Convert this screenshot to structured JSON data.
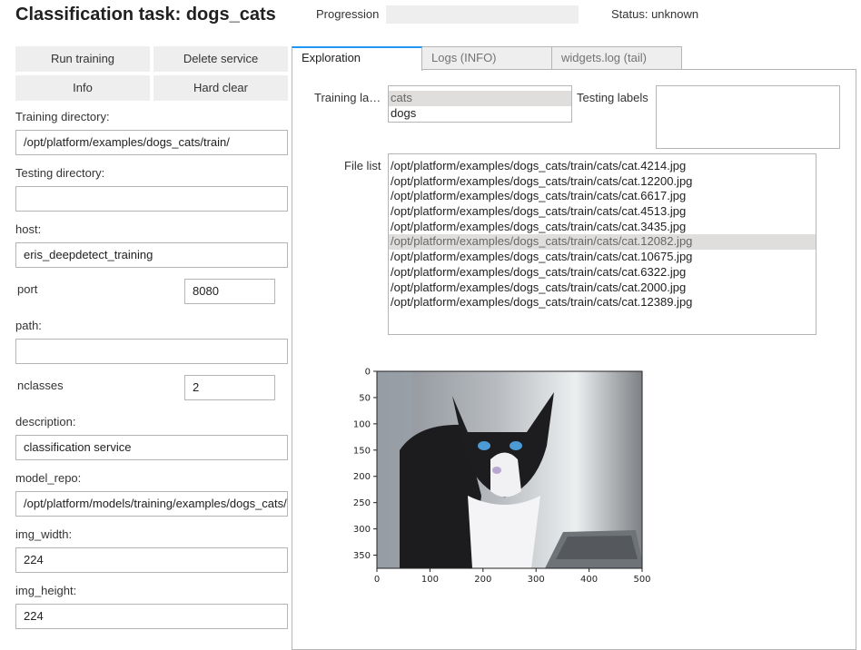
{
  "header": {
    "title": "Classification task: dogs_cats",
    "progress_label": "Progression",
    "progress_value": 0,
    "status": "Status: unknown"
  },
  "actions": {
    "run_training": "Run training",
    "delete_service": "Delete service",
    "info": "Info",
    "hard_clear": "Hard clear"
  },
  "form": {
    "training_directory": {
      "label": "Training directory:",
      "value": "/opt/platform/examples/dogs_cats/train/"
    },
    "testing_directory": {
      "label": "Testing directory:",
      "value": ""
    },
    "host": {
      "label": "host:",
      "value": "eris_deepdetect_training"
    },
    "port": {
      "label": "port",
      "value": "8080"
    },
    "path": {
      "label": "path:",
      "value": ""
    },
    "nclasses": {
      "label": "nclasses",
      "value": "2"
    },
    "description": {
      "label": "description:",
      "value": "classification service"
    },
    "model_repo": {
      "label": "model_repo:",
      "value": "/opt/platform/models/training/examples/dogs_cats/"
    },
    "img_width": {
      "label": "img_width:",
      "value": "224"
    },
    "img_height": {
      "label": "img_height:",
      "value": "224"
    }
  },
  "tabs": [
    {
      "label": "Exploration",
      "active": true
    },
    {
      "label": "Logs (INFO)",
      "active": false
    },
    {
      "label": "widgets.log (tail)",
      "active": false
    }
  ],
  "exploration": {
    "training_labels_label": "Training la…",
    "training_labels": [
      {
        "text": "cats",
        "selected": true
      },
      {
        "text": "dogs",
        "selected": false
      }
    ],
    "testing_labels_label": "Testing labels",
    "testing_labels": [],
    "file_list_label": "File list",
    "files": [
      {
        "text": "/opt/platform/examples/dogs_cats/train/cats/cat.4214.jpg",
        "selected": false
      },
      {
        "text": "/opt/platform/examples/dogs_cats/train/cats/cat.12200.jpg",
        "selected": false
      },
      {
        "text": "/opt/platform/examples/dogs_cats/train/cats/cat.6617.jpg",
        "selected": false
      },
      {
        "text": "/opt/platform/examples/dogs_cats/train/cats/cat.4513.jpg",
        "selected": false
      },
      {
        "text": "/opt/platform/examples/dogs_cats/train/cats/cat.3435.jpg",
        "selected": false
      },
      {
        "text": "/opt/platform/examples/dogs_cats/train/cats/cat.12082.jpg",
        "selected": true
      },
      {
        "text": "/opt/platform/examples/dogs_cats/train/cats/cat.10675.jpg",
        "selected": false
      },
      {
        "text": "/opt/platform/examples/dogs_cats/train/cats/cat.6322.jpg",
        "selected": false
      },
      {
        "text": "/opt/platform/examples/dogs_cats/train/cats/cat.2000.jpg",
        "selected": false
      },
      {
        "text": "/opt/platform/examples/dogs_cats/train/cats/cat.12389.jpg",
        "selected": false
      }
    ],
    "image_preview": {
      "subject": "black-and-white cat with blue eyes",
      "x_ticks": [
        "0",
        "100",
        "200",
        "300",
        "400",
        "500"
      ],
      "y_ticks": [
        "0",
        "50",
        "100",
        "150",
        "200",
        "250",
        "300",
        "350"
      ],
      "xlim": [
        0,
        500
      ],
      "ylim": [
        375,
        0
      ]
    }
  }
}
